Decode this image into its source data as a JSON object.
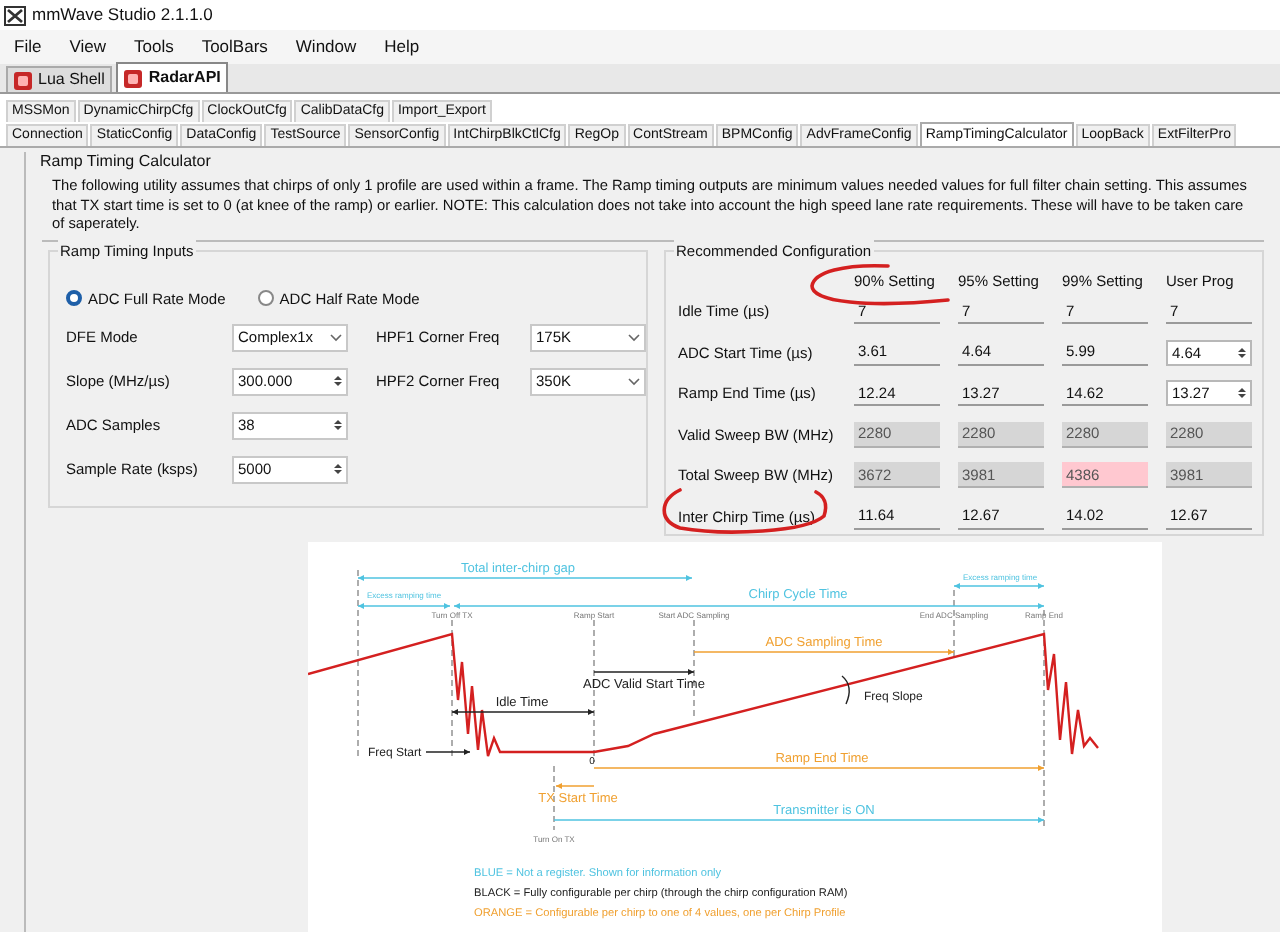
{
  "window": {
    "title": "mmWave Studio 2.1.1.0"
  },
  "menu": [
    "File",
    "View",
    "Tools",
    "ToolBars",
    "Window",
    "Help"
  ],
  "main_tabs": [
    {
      "label": "Lua Shell",
      "selected": false
    },
    {
      "label": "RadarAPI",
      "selected": true
    }
  ],
  "sub_tabs_row1": [
    {
      "label": "MSSMon",
      "selected": false
    },
    {
      "label": "DynamicChirpCfg",
      "selected": false
    },
    {
      "label": "ClockOutCfg",
      "selected": false
    },
    {
      "label": "CalibDataCfg",
      "selected": false
    },
    {
      "label": "Import_Export",
      "selected": false
    }
  ],
  "sub_tabs_row2": [
    {
      "label": "Connection",
      "selected": false
    },
    {
      "label": "StaticConfig",
      "selected": false
    },
    {
      "label": "DataConfig",
      "selected": false
    },
    {
      "label": "TestSource",
      "selected": false
    },
    {
      "label": "SensorConfig",
      "selected": false
    },
    {
      "label": "IntChirpBlkCtlCfg",
      "selected": false
    },
    {
      "label": "RegOp",
      "selected": false
    },
    {
      "label": "ContStream",
      "selected": false
    },
    {
      "label": "BPMConfig",
      "selected": false
    },
    {
      "label": "AdvFrameConfig",
      "selected": false
    },
    {
      "label": "RampTimingCalculator",
      "selected": true
    },
    {
      "label": "LoopBack",
      "selected": false
    },
    {
      "label": "ExtFilterPro",
      "selected": false
    }
  ],
  "calculator": {
    "title": "Ramp Timing Calculator",
    "description": "The following utility assumes that chirps of only 1 profile are used within a frame.  The Ramp timing outputs are minimum values needed values for full filter chain setting. This assumes that TX start time is set to 0 (at knee of the ramp) or earlier. NOTE: This calculation does not take into account the high speed lane rate requirements. These will have to be taken care of saperately.",
    "inputs": {
      "title": "Ramp Timing Inputs",
      "modes": [
        {
          "label": "ADC Full Rate Mode",
          "selected": true
        },
        {
          "label": "ADC Half Rate Mode",
          "selected": false
        }
      ],
      "rows": [
        [
          {
            "label": "DFE Mode",
            "kind": "combo",
            "value": "Complex1x"
          },
          {
            "label": "HPF1 Corner Freq",
            "kind": "combo",
            "value": "175K"
          }
        ],
        [
          {
            "label": "Slope (MHz/µs)",
            "kind": "spin",
            "value": "300.000"
          },
          {
            "label": "HPF2 Corner Freq",
            "kind": "combo",
            "value": "350K"
          }
        ],
        [
          {
            "label": "ADC Samples",
            "kind": "spin",
            "value": "38"
          }
        ],
        [
          {
            "label": "Sample Rate (ksps)",
            "kind": "spin",
            "value": "5000"
          }
        ]
      ]
    },
    "recommended": {
      "title": "Recommended Configuration",
      "columns": [
        "90% Setting",
        "95% Setting",
        "99% Setting",
        "User Prog"
      ],
      "rows": [
        {
          "label": "Idle Time (µs)",
          "cells": [
            {
              "value": "7",
              "kind": "readonly"
            },
            {
              "value": "7",
              "kind": "readonly"
            },
            {
              "value": "7",
              "kind": "readonly"
            },
            {
              "value": "7",
              "kind": "readonly"
            }
          ]
        },
        {
          "label": "ADC Start Time (µs)",
          "cells": [
            {
              "value": "3.61",
              "kind": "readonly"
            },
            {
              "value": "4.64",
              "kind": "readonly"
            },
            {
              "value": "5.99",
              "kind": "readonly"
            },
            {
              "value": "4.64",
              "kind": "spin"
            }
          ]
        },
        {
          "label": "Ramp End Time (µs)",
          "cells": [
            {
              "value": "12.24",
              "kind": "readonly"
            },
            {
              "value": "13.27",
              "kind": "readonly"
            },
            {
              "value": "14.62",
              "kind": "readonly"
            },
            {
              "value": "13.27",
              "kind": "spin"
            }
          ]
        },
        {
          "label": "Valid Sweep BW (MHz)",
          "cells": [
            {
              "value": "2280",
              "kind": "grayed"
            },
            {
              "value": "2280",
              "kind": "grayed"
            },
            {
              "value": "2280",
              "kind": "grayed"
            },
            {
              "value": "2280",
              "kind": "grayed"
            }
          ]
        },
        {
          "label": "Total Sweep BW (MHz)",
          "cells": [
            {
              "value": "3672",
              "kind": "grayed"
            },
            {
              "value": "3981",
              "kind": "grayed"
            },
            {
              "value": "4386",
              "kind": "alert"
            },
            {
              "value": "3981",
              "kind": "grayed"
            }
          ]
        },
        {
          "label": "Inter Chirp Time (µs)",
          "cells": [
            {
              "value": "11.64",
              "kind": "readonly"
            },
            {
              "value": "12.67",
              "kind": "readonly"
            },
            {
              "value": "14.02",
              "kind": "readonly"
            },
            {
              "value": "12.67",
              "kind": "readonly"
            }
          ]
        }
      ]
    },
    "diagram": {
      "total_gap": "Total inter-chirp gap",
      "excess_left": "Excess ramping time",
      "chirp_cycle": "Chirp Cycle Time",
      "excess_right": "Excess ramping time",
      "turn_off_tx": "Turn Off TX",
      "ramp_start": "Ramp Start",
      "start_adc": "Start ADC Sampling",
      "end_adc": "End ADC Sampling",
      "ramp_end": "Ramp End",
      "adc_sampling_time": "ADC Sampling Time",
      "adc_valid_start": "ADC Valid Start Time",
      "idle_time": "Idle Time",
      "freq_slope": "Freq Slope",
      "freq_start": "Freq Start",
      "zero": "0",
      "ramp_end_time": "Ramp End Time",
      "tx_start_time": "TX Start Time",
      "turn_on_tx": "Turn On TX",
      "transmitter_on": "Transmitter is ON",
      "legend": [
        {
          "text": "BLUE = Not a register. Shown for information only",
          "color": "#4fc3e0"
        },
        {
          "text": "BLACK = Fully configurable per chirp (through the chirp configuration RAM)",
          "color": "#222222"
        },
        {
          "text": "ORANGE = Configurable per chirp to one of 4 values, one per Chirp Profile",
          "color": "#f0a030"
        }
      ]
    }
  }
}
